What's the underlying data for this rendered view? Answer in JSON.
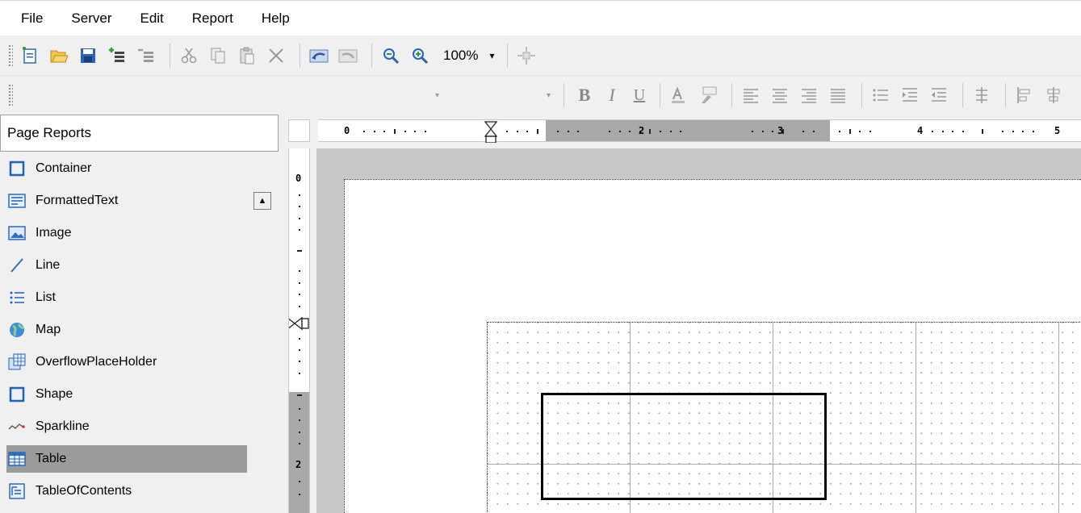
{
  "menu": [
    "File",
    "Server",
    "Edit",
    "Report",
    "Help"
  ],
  "toolbar": {
    "zoom_value": "100%",
    "zoom_arrow": "▾",
    "font_arrow": "▾",
    "size_arrow": "▾",
    "bold": "B",
    "italic": "I",
    "underline": "U"
  },
  "panel": {
    "title": "Page Reports",
    "scroll_up": "▲",
    "items": [
      {
        "label": "Container",
        "icon": "container-icon"
      },
      {
        "label": "FormattedText",
        "icon": "formatted-text-icon"
      },
      {
        "label": "Image",
        "icon": "image-icon"
      },
      {
        "label": "Line",
        "icon": "line-icon"
      },
      {
        "label": "List",
        "icon": "list-icon"
      },
      {
        "label": "Map",
        "icon": "map-icon"
      },
      {
        "label": "OverflowPlaceHolder",
        "icon": "overflow-placeholder-icon"
      },
      {
        "label": "Shape",
        "icon": "shape-icon"
      },
      {
        "label": "Sparkline",
        "icon": "sparkline-icon"
      },
      {
        "label": "Table",
        "icon": "table-icon",
        "selected": true
      },
      {
        "label": "TableOfContents",
        "icon": "table-of-contents-icon"
      }
    ]
  },
  "ruler": {
    "h_numbers": [
      "0",
      "2",
      "3",
      "4",
      "5"
    ],
    "v_numbers": [
      "0",
      "2"
    ]
  },
  "colors": {
    "selection": "#9b9b9b",
    "canvas": "#c8c8c8",
    "icon_blue": "#1f5fbf"
  }
}
